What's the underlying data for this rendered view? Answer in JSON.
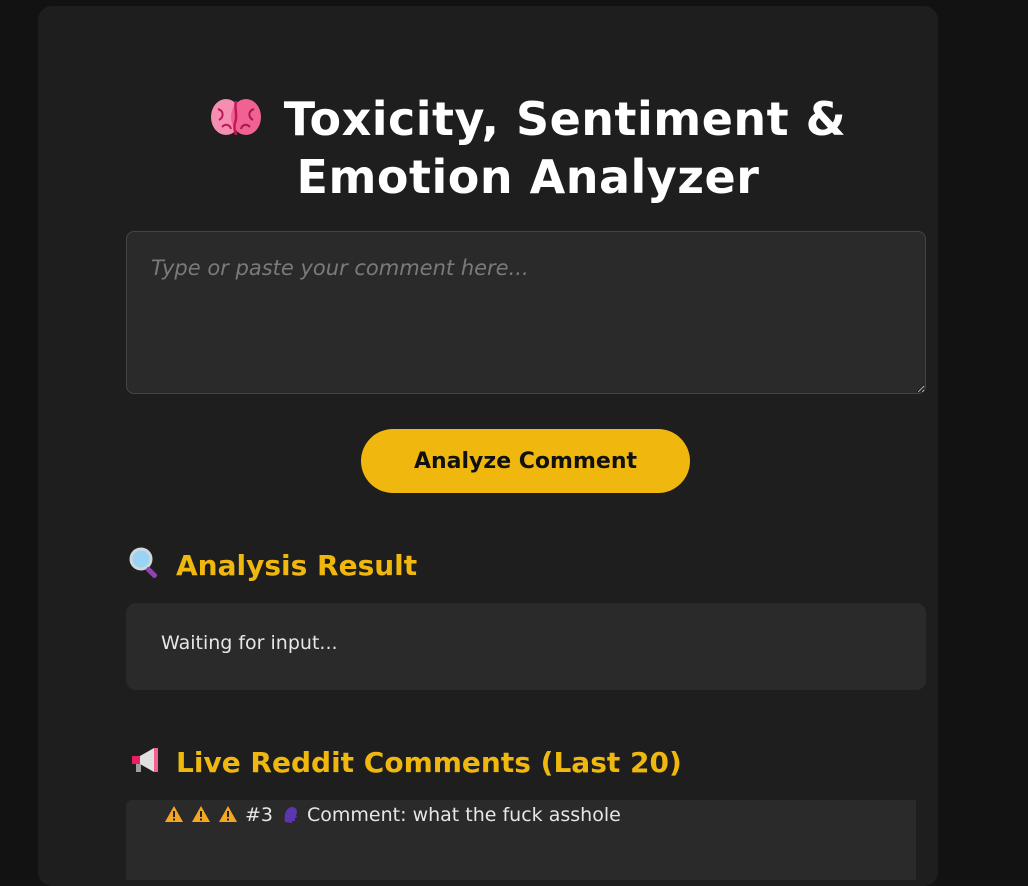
{
  "header": {
    "title_line1": "Toxicity, Sentiment &",
    "title_line2": "Emotion Analyzer",
    "icon": "brain-icon"
  },
  "input": {
    "placeholder": "Type or paste your comment here..."
  },
  "analyze_button": {
    "label": "Analyze Comment"
  },
  "result": {
    "heading": "Analysis Result",
    "icon": "magnifier-icon",
    "status": "Waiting for input..."
  },
  "live": {
    "heading": "Live Reddit Comments (Last 20)",
    "icon": "megaphone-icon",
    "items": [
      {
        "number": "#3",
        "label": "Comment:",
        "text": "what the fuck asshole",
        "warning_count": 3
      }
    ]
  },
  "colors": {
    "accent": "#f0b80e",
    "background": "#121212",
    "card": "#1e1e1e",
    "panel": "#2a2a2a"
  }
}
